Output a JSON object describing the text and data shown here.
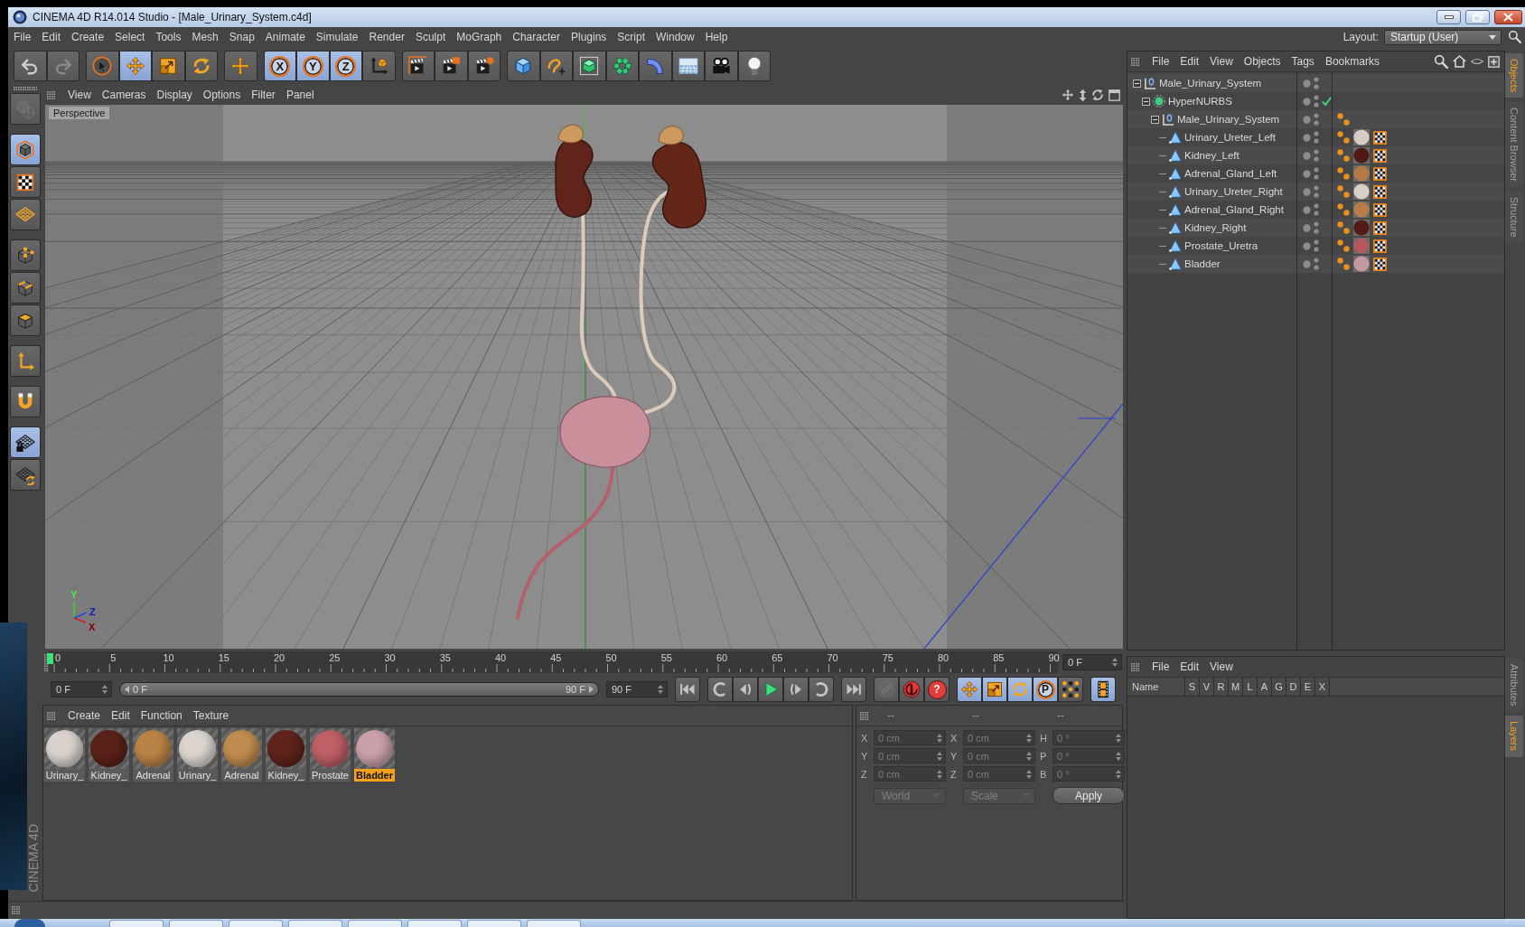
{
  "window": {
    "title": "CINEMA 4D R14.014 Studio - [Male_Urinary_System.c4d]"
  },
  "menu_bar": {
    "items": [
      "File",
      "Edit",
      "Create",
      "Select",
      "Tools",
      "Mesh",
      "Snap",
      "Animate",
      "Simulate",
      "Render",
      "Sculpt",
      "MoGraph",
      "Character",
      "Plugins",
      "Script",
      "Window",
      "Help"
    ],
    "layout_label": "Layout:",
    "layout_value": "Startup (User)"
  },
  "toolbar": [
    {
      "items": [
        {
          "kind": "undo",
          "selected": false,
          "disabled": false
        },
        {
          "kind": "redo",
          "selected": false,
          "disabled": true
        }
      ]
    },
    {
      "items": [
        {
          "kind": "select",
          "selected": false,
          "disabled": false
        },
        {
          "kind": "move",
          "selected": true,
          "disabled": false
        },
        {
          "kind": "scale",
          "selected": false,
          "disabled": false
        },
        {
          "kind": "rotate",
          "selected": false,
          "disabled": false
        }
      ]
    },
    {
      "items": [
        {
          "kind": "last",
          "selected": false,
          "disabled": false
        }
      ]
    },
    {
      "items": [
        {
          "kind": "axis",
          "label": "X",
          "selected": true,
          "disabled": false
        },
        {
          "kind": "axis",
          "label": "Y",
          "selected": true,
          "disabled": false
        },
        {
          "kind": "axis",
          "label": "Z",
          "selected": true,
          "disabled": false
        },
        {
          "kind": "world",
          "selected": false,
          "disabled": false
        }
      ]
    },
    {
      "items": [
        {
          "kind": "render",
          "selected": false,
          "disabled": false
        },
        {
          "kind": "viewer",
          "selected": false,
          "disabled": false
        },
        {
          "kind": "settings",
          "selected": false,
          "disabled": false
        }
      ]
    },
    {
      "items": [
        {
          "kind": "cube",
          "selected": false,
          "disabled": false
        },
        {
          "kind": "spline",
          "selected": false,
          "disabled": false
        },
        {
          "kind": "nurbs",
          "selected": false,
          "disabled": false
        },
        {
          "kind": "cloner",
          "selected": false,
          "disabled": false
        },
        {
          "kind": "deformer",
          "selected": false,
          "disabled": false
        },
        {
          "kind": "floor",
          "selected": false,
          "disabled": false
        },
        {
          "kind": "camera",
          "selected": false,
          "disabled": false
        },
        {
          "kind": "light",
          "selected": false,
          "disabled": false
        }
      ]
    }
  ],
  "left_toolbar": {
    "groups": [
      {
        "items": [
          {
            "kind": "editable",
            "selected": false,
            "disabled": true
          }
        ]
      },
      {
        "items": [
          {
            "kind": "model",
            "selected": true,
            "disabled": false
          },
          {
            "kind": "texture",
            "selected": false,
            "disabled": false
          },
          {
            "kind": "workplane",
            "selected": false,
            "disabled": false
          }
        ]
      },
      {
        "items": [
          {
            "kind": "points",
            "selected": false,
            "disabled": false
          },
          {
            "kind": "edges",
            "selected": false,
            "disabled": false
          },
          {
            "kind": "polygons",
            "selected": false,
            "disabled": false
          }
        ]
      },
      {
        "items": [
          {
            "kind": "axis",
            "selected": false,
            "disabled": false
          }
        ]
      },
      {
        "items": [
          {
            "kind": "snap",
            "selected": false,
            "disabled": false
          }
        ]
      },
      {
        "items": [
          {
            "kind": "lock",
            "selected": true,
            "disabled": false
          },
          {
            "kind": "planar",
            "selected": false,
            "disabled": false
          }
        ]
      }
    ],
    "logo": "CINEMA 4D"
  },
  "viewport": {
    "menu": [
      "View",
      "Cameras",
      "Display",
      "Options",
      "Filter",
      "Panel"
    ],
    "camera": "Perspective",
    "axis_labels": [
      "Y",
      "Z",
      "X"
    ]
  },
  "timeline": {
    "ticks": [
      "0",
      "5",
      "10",
      "15",
      "20",
      "25",
      "30",
      "35",
      "40",
      "45",
      "50",
      "55",
      "60",
      "65",
      "70",
      "75",
      "80",
      "85",
      "90"
    ],
    "playhead": {
      "level": 0
    },
    "current_frame": "0 F",
    "start": "0 F",
    "range": {
      "start": "0 F",
      "end": "90 F",
      "level": 1
    },
    "end": "90 F",
    "controls": [
      {
        "items": [
          {
            "kind": "first",
            "selected": false,
            "disabled": false
          }
        ]
      },
      {
        "items": [
          {
            "kind": "prevkey",
            "selected": false,
            "disabled": false
          },
          {
            "kind": "prevframe",
            "selected": false,
            "disabled": false
          },
          {
            "kind": "play",
            "selected": false,
            "disabled": false
          },
          {
            "kind": "nextframe",
            "selected": false,
            "disabled": false
          },
          {
            "kind": "nextkey",
            "selected": false,
            "disabled": false
          }
        ]
      },
      {
        "items": [
          {
            "kind": "last",
            "selected": false,
            "disabled": false
          }
        ]
      },
      {
        "items": [
          {
            "kind": "link",
            "selected": false,
            "disabled": true
          },
          {
            "kind": "record",
            "selected": false,
            "disabled": false
          },
          {
            "kind": "help",
            "label": "?",
            "selected": false,
            "disabled": false
          }
        ]
      },
      {
        "items": [
          {
            "kind": "position",
            "selected": true,
            "disabled": false
          },
          {
            "kind": "scale",
            "selected": true,
            "disabled": false
          },
          {
            "kind": "rotation",
            "selected": true,
            "disabled": false
          },
          {
            "kind": "param",
            "label": "P",
            "selected": true,
            "disabled": false
          },
          {
            "kind": "points",
            "selected": false,
            "disabled": false
          }
        ]
      },
      {
        "items": [
          {
            "kind": "timeline",
            "selected": true,
            "disabled": false
          }
        ]
      }
    ]
  },
  "materials": {
    "menu": [
      "Create",
      "Edit",
      "Function",
      "Texture"
    ],
    "items": [
      {
        "name": "Urinary_",
        "color": "#d9d2cc",
        "selected": false
      },
      {
        "name": "Kidney_",
        "color": "#5b2219",
        "selected": false
      },
      {
        "name": "Adrenal",
        "color": "#b98346",
        "selected": false
      },
      {
        "name": "Urinary_",
        "color": "#dcd5cf",
        "selected": false
      },
      {
        "name": "Adrenal",
        "color": "#c08c4f",
        "selected": false
      },
      {
        "name": "Kidney_",
        "color": "#5e241b",
        "selected": false
      },
      {
        "name": "Prostate",
        "color": "#bf5f66",
        "selected": false
      },
      {
        "name": "Bladder",
        "color": "#caa0aa",
        "selected": true
      }
    ]
  },
  "coordinates": {
    "headers": [
      "--",
      "--",
      "--"
    ],
    "rows": [
      {
        "cells": [
          {
            "axis": "X",
            "value": "0 cm"
          },
          {
            "axis": "X",
            "value": "0 cm"
          },
          {
            "axis": "H",
            "value": "0 °"
          }
        ]
      },
      {
        "cells": [
          {
            "axis": "Y",
            "value": "0 cm"
          },
          {
            "axis": "Y",
            "value": "0 cm"
          },
          {
            "axis": "P",
            "value": "0 °"
          }
        ]
      },
      {
        "cells": [
          {
            "axis": "Z",
            "value": "0 cm"
          },
          {
            "axis": "Z",
            "value": "0 cm"
          },
          {
            "axis": "B",
            "value": "0 °"
          }
        ]
      }
    ],
    "controls": [
      {
        "kind": "dropdown",
        "value": "World",
        "disabled": true
      },
      {
        "kind": "dropdown",
        "value": "Scale",
        "disabled": true
      },
      {
        "kind": "button",
        "value": "Apply",
        "disabled": false
      }
    ]
  },
  "object_manager": {
    "menu": [
      "File",
      "Edit",
      "View",
      "Objects",
      "Tags",
      "Bookmarks"
    ],
    "objects": [
      {
        "name": "Male_Urinary_System",
        "kind": "null",
        "expanded": true,
        "children": [
          {
            "name": "HyperNURBS",
            "kind": "hypernurbs",
            "expanded": true,
            "enabled": true,
            "children": [
              {
                "name": "Male_Urinary_System",
                "kind": "null",
                "expanded": true,
                "tags": [
                  {
                    "kind": "phong"
                  }
                ],
                "children": [
                  {
                    "name": "Urinary_Ureter_Left",
                    "kind": "polygon",
                    "tags": [
                      {
                        "kind": "phong"
                      },
                      {
                        "kind": "material",
                        "color": "#d6cdc6"
                      },
                      {
                        "kind": "uvw"
                      }
                    ]
                  },
                  {
                    "name": "Kidney_Left",
                    "kind": "polygon",
                    "tags": [
                      {
                        "kind": "phong"
                      },
                      {
                        "kind": "material",
                        "color": "#4e1a12"
                      },
                      {
                        "kind": "uvw"
                      }
                    ]
                  },
                  {
                    "name": "Adrenal_Gland_Left",
                    "kind": "polygon",
                    "tags": [
                      {
                        "kind": "phong"
                      },
                      {
                        "kind": "material",
                        "color": "#b07a42"
                      },
                      {
                        "kind": "uvw"
                      }
                    ]
                  },
                  {
                    "name": "Urinary_Ureter_Right",
                    "kind": "polygon",
                    "tags": [
                      {
                        "kind": "phong"
                      },
                      {
                        "kind": "material",
                        "color": "#d8cfc8"
                      },
                      {
                        "kind": "uvw"
                      }
                    ]
                  },
                  {
                    "name": "Adrenal_Gland_Right",
                    "kind": "polygon",
                    "tags": [
                      {
                        "kind": "phong"
                      },
                      {
                        "kind": "material",
                        "color": "#b47e46"
                      },
                      {
                        "kind": "uvw"
                      }
                    ]
                  },
                  {
                    "name": "Kidney_Right",
                    "kind": "polygon",
                    "tags": [
                      {
                        "kind": "phong"
                      },
                      {
                        "kind": "material",
                        "color": "#521c14"
                      },
                      {
                        "kind": "uvw"
                      }
                    ]
                  },
                  {
                    "name": "Prostate_Uretra",
                    "kind": "polygon",
                    "tags": [
                      {
                        "kind": "phong"
                      },
                      {
                        "kind": "material",
                        "color": "#b2585e"
                      },
                      {
                        "kind": "uvw"
                      }
                    ]
                  },
                  {
                    "name": "Bladder",
                    "kind": "polygon",
                    "tags": [
                      {
                        "kind": "phong"
                      },
                      {
                        "kind": "material",
                        "color": "#c49aa2"
                      },
                      {
                        "kind": "uvw"
                      }
                    ]
                  }
                ]
              }
            ]
          }
        ]
      }
    ]
  },
  "layer_manager": {
    "menu": [
      "File",
      "Edit",
      "View"
    ],
    "columns": [
      "Name",
      "S",
      "V",
      "R",
      "M",
      "L",
      "A",
      "G",
      "D",
      "E",
      "X"
    ]
  },
  "side_tabs": {
    "top": [
      {
        "label": "Objects",
        "selected": true
      },
      {
        "label": "Content Browser",
        "selected": false
      },
      {
        "label": "Structure",
        "selected": false
      }
    ],
    "bottom": [
      {
        "label": "Attributes",
        "selected": false
      },
      {
        "label": "Layers",
        "selected": true
      }
    ]
  }
}
